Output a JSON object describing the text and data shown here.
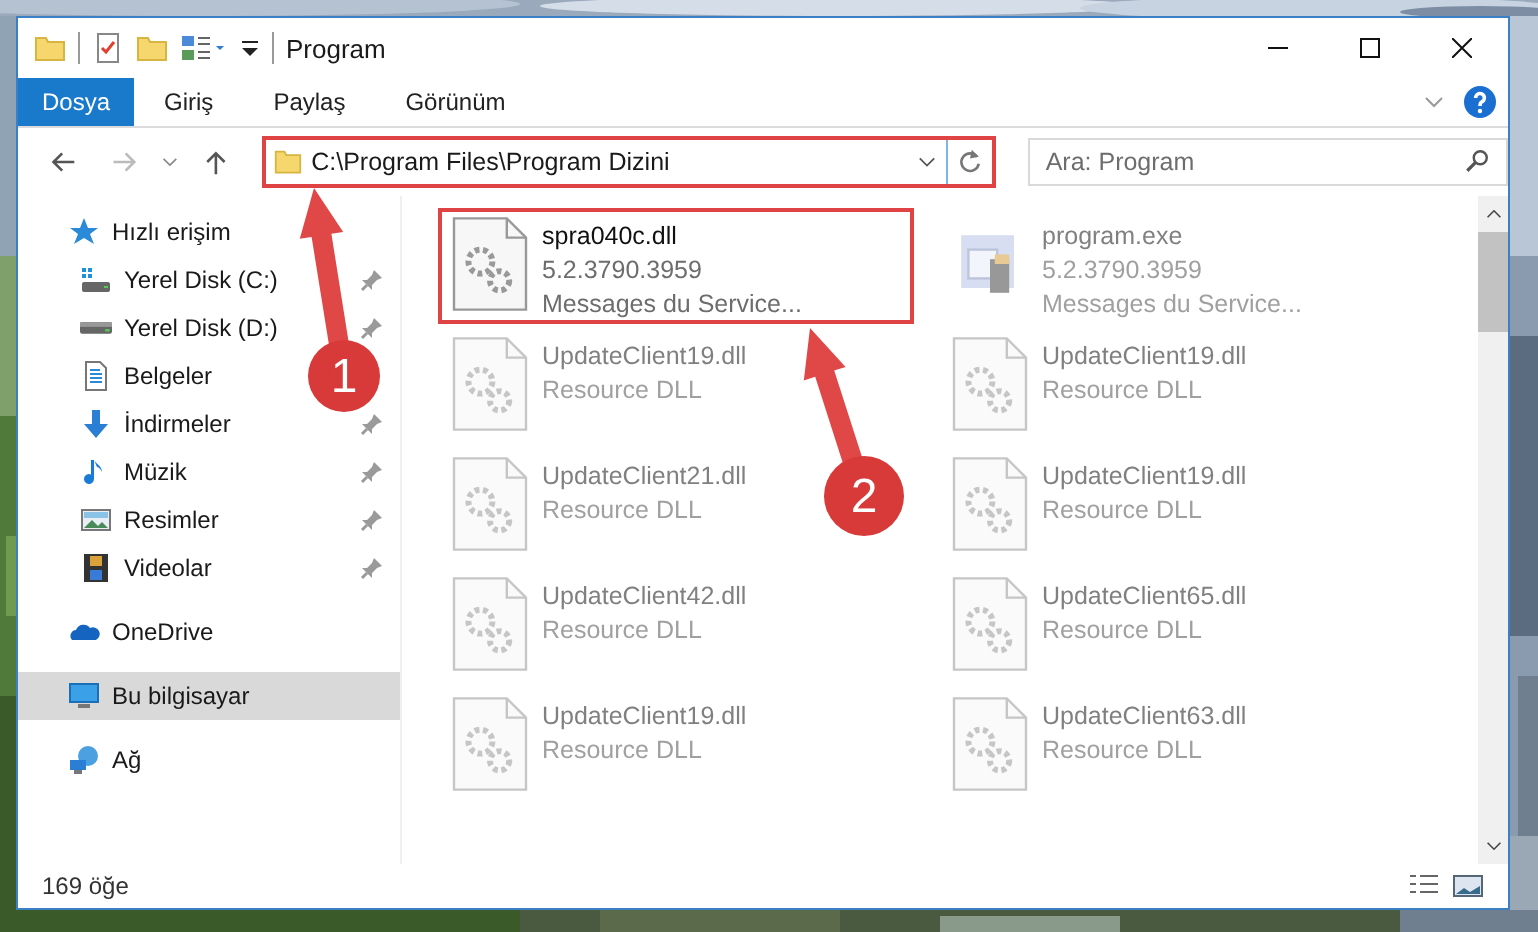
{
  "title_bar": {
    "title": "Program"
  },
  "ribbon_tabs": [
    {
      "label": "Dosya",
      "selected": true
    },
    {
      "label": "Giriş",
      "selected": false
    },
    {
      "label": "Paylaş",
      "selected": false
    },
    {
      "label": "Görünüm",
      "selected": false
    }
  ],
  "address_bar": {
    "path": "C:\\Program Files\\Program Dizini",
    "highlighted": true
  },
  "search": {
    "placeholder": "Ara: Program"
  },
  "nav_pane": [
    {
      "label": "Hızlı erişim",
      "kind": "star",
      "selected": false,
      "children": [
        {
          "label": "Yerel Disk (C:)",
          "kind": "system-drive",
          "pinned": true,
          "selected": false
        },
        {
          "label": "Yerel Disk (D:)",
          "kind": "drive",
          "pinned": true,
          "selected": false
        },
        {
          "label": "Belgeler",
          "kind": "document",
          "pinned": false,
          "selected": false
        },
        {
          "label": "İndirmeler",
          "kind": "download",
          "pinned": true,
          "selected": false
        },
        {
          "label": "Müzik",
          "kind": "music",
          "pinned": true,
          "selected": false
        },
        {
          "label": "Resimler",
          "kind": "pictures",
          "pinned": true,
          "selected": false
        },
        {
          "label": "Videolar",
          "kind": "video",
          "pinned": true,
          "selected": false
        }
      ]
    },
    {
      "label": "OneDrive",
      "kind": "cloud",
      "selected": false
    },
    {
      "label": "Bu bilgisayar",
      "kind": "computer",
      "selected": true
    },
    {
      "label": "Ağ",
      "kind": "network",
      "selected": false
    }
  ],
  "files": [
    {
      "name": "spra040c.dll",
      "line_2": "5.2.3790.3959",
      "line_3": "Messages du Service...",
      "kind": "dll",
      "highlighted": true,
      "blurred": false
    },
    {
      "name": "program.exe",
      "line_2": "5.2.3790.3959",
      "line_3": "Messages du Service...",
      "kind": "exe",
      "highlighted": false,
      "blurred": true
    },
    {
      "name": "UpdateClient19.dll",
      "line_2": "Resource DLL",
      "kind": "dll",
      "highlighted": false,
      "blurred": true
    },
    {
      "name": "UpdateClient19.dll",
      "line_2": "Resource DLL",
      "kind": "dll",
      "highlighted": false,
      "blurred": true
    },
    {
      "name": "UpdateClient21.dll",
      "line_2": "Resource DLL",
      "kind": "dll",
      "highlighted": false,
      "blurred": true
    },
    {
      "name": "UpdateClient19.dll",
      "line_2": "Resource DLL",
      "kind": "dll",
      "highlighted": false,
      "blurred": true
    },
    {
      "name": "UpdateClient42.dll",
      "line_2": "Resource DLL",
      "kind": "dll",
      "highlighted": false,
      "blurred": true
    },
    {
      "name": "UpdateClient65.dll",
      "line_2": "Resource DLL",
      "kind": "dll",
      "highlighted": false,
      "blurred": true
    },
    {
      "name": "UpdateClient19.dll",
      "line_2": "Resource DLL",
      "kind": "dll",
      "highlighted": false,
      "blurred": true
    },
    {
      "name": "UpdateClient63.dll",
      "line_2": "Resource DLL",
      "kind": "dll",
      "highlighted": false,
      "blurred": true
    }
  ],
  "status_bar": {
    "count": "169 öğe"
  },
  "annotations": [
    {
      "label": "1"
    },
    {
      "label": "2"
    }
  ]
}
